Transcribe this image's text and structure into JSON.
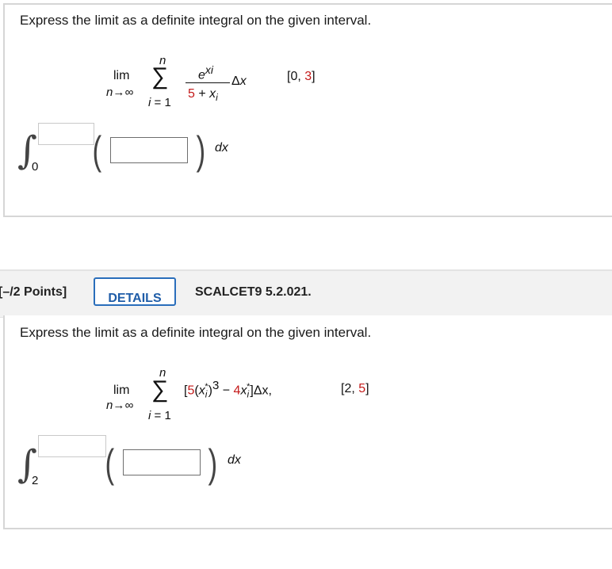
{
  "q1": {
    "instruction": "Express the limit as a definite integral on the given interval.",
    "lim": "lim",
    "lim_sub": "n→∞",
    "sigma": "∑",
    "sigma_top": "n",
    "sigma_bottom": "i = 1",
    "numer": "e",
    "numer_exp": "xi",
    "denom_a": "5 + ",
    "denom_b": "x",
    "denom_sub": "i",
    "delta": "Δx",
    "interval_open": "[0, ",
    "interval_num": "3",
    "interval_close": "]",
    "lower_limit": "0",
    "dx": "dx",
    "upper_input_value": "",
    "integrand_input_value": ""
  },
  "q2": {
    "points": "[–/2 Points]",
    "details": "DETAILS",
    "source": "SCALCET9 5.2.021.",
    "instruction": "Express the limit as a definite integral on the given interval.",
    "lim": "lim",
    "lim_sub": "n→∞",
    "sigma": "∑",
    "sigma_top": "n",
    "sigma_bottom": "i = 1",
    "expr_a": "[",
    "expr_b": "5",
    "expr_c": "(x",
    "expr_sub": "i",
    "expr_star": "*",
    "expr_d": ")",
    "expr_exp": "3",
    "expr_e": " − ",
    "expr_f": "4",
    "expr_g": "x",
    "expr_sub2": "i",
    "expr_star2": "*",
    "expr_h": "]Δx,",
    "interval_open": "[2, ",
    "interval_num": "5",
    "interval_close": "]",
    "lower_limit": "2",
    "dx": "dx",
    "upper_input_value": "",
    "integrand_input_value": ""
  }
}
